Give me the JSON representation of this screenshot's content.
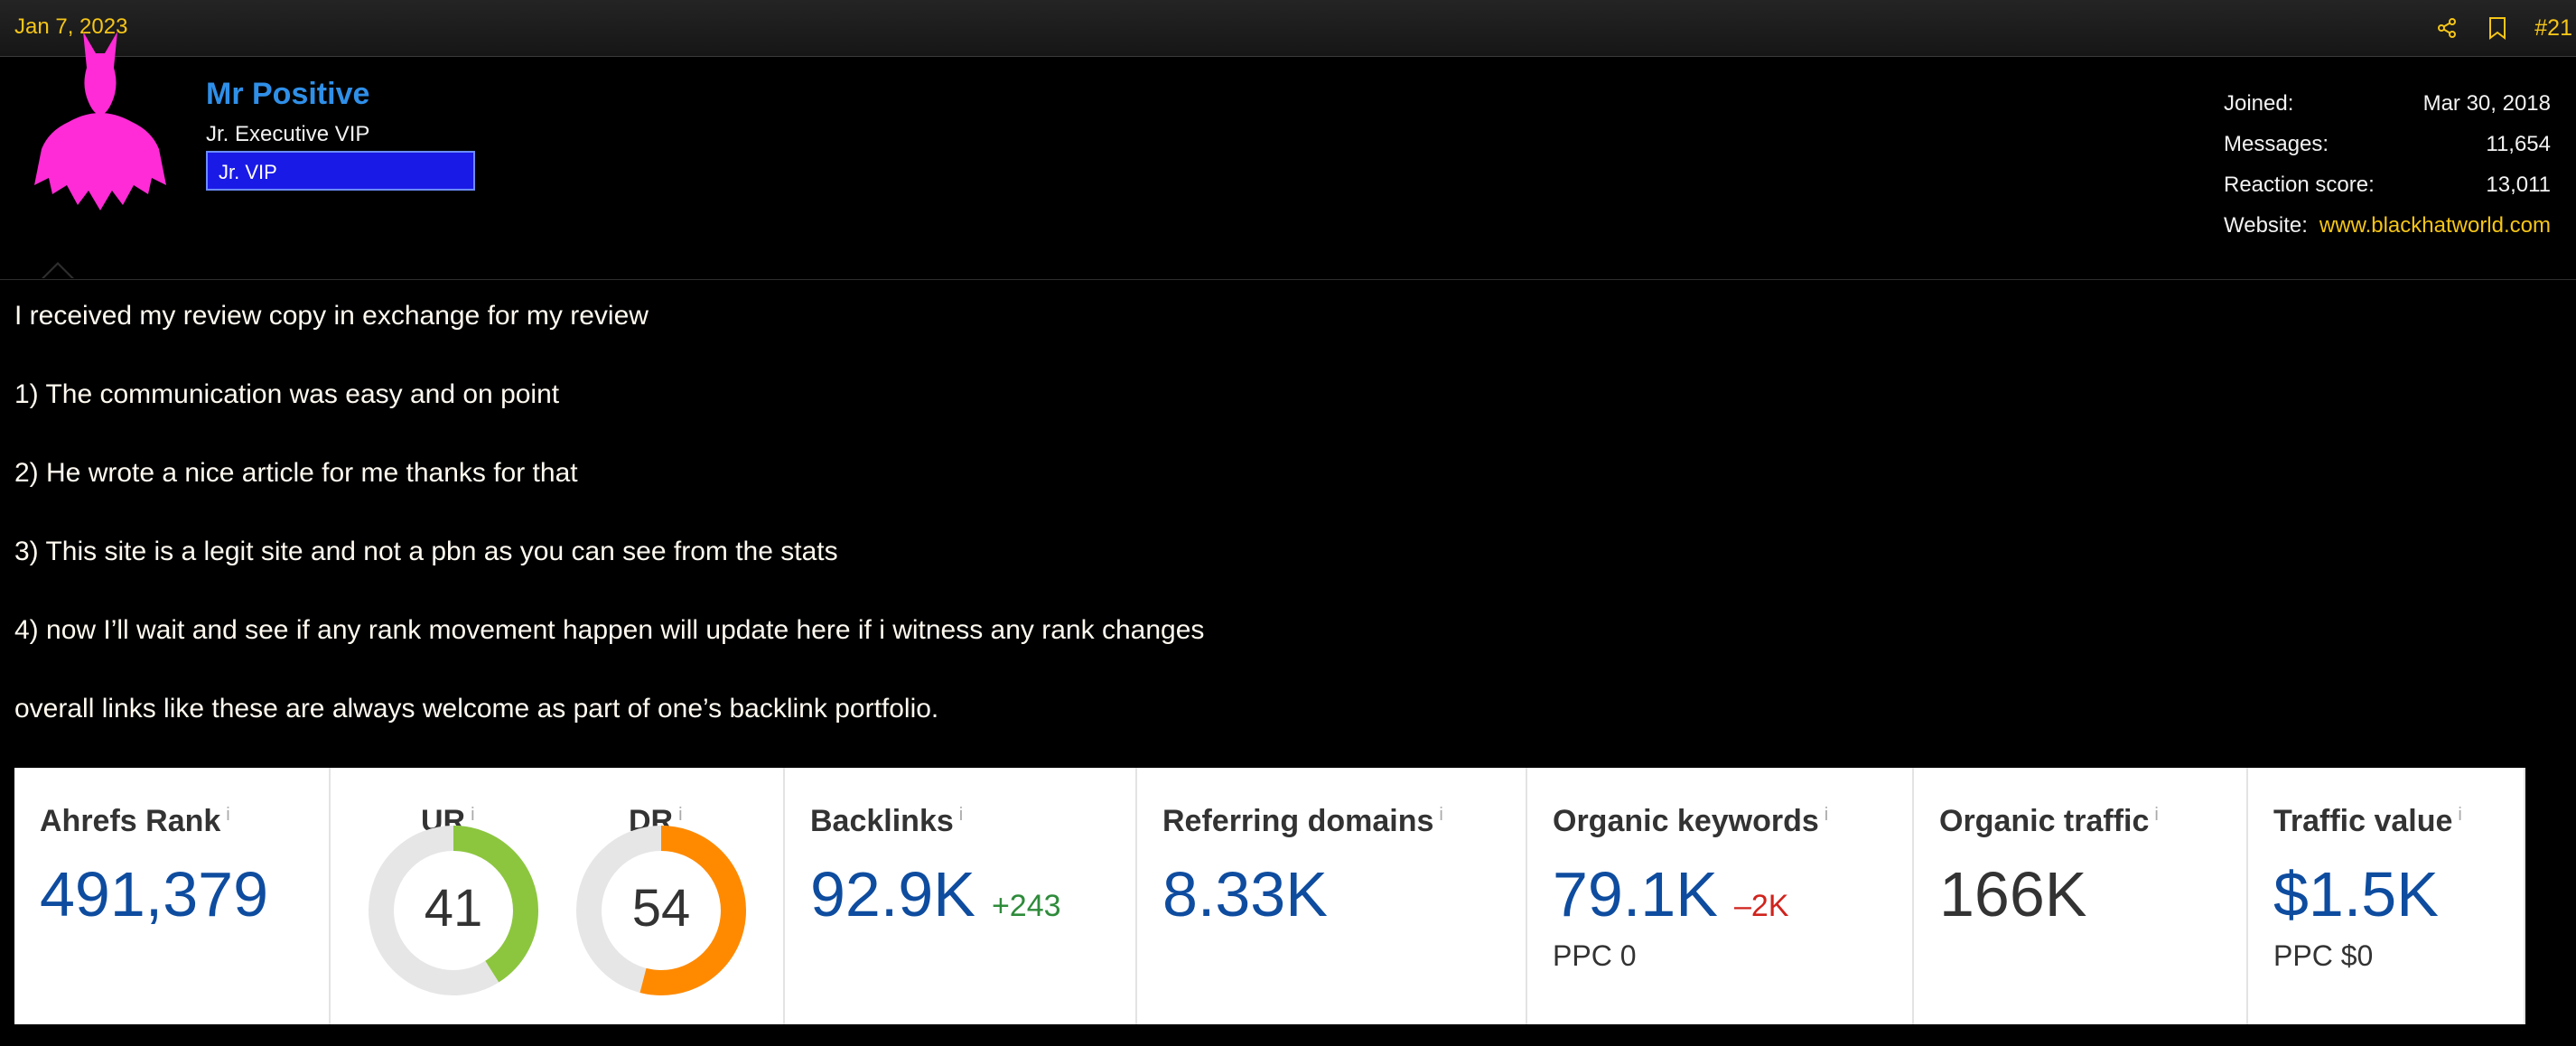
{
  "post": {
    "date": "Jan 7, 2023",
    "number": "#21"
  },
  "user": {
    "name": "Mr Positive",
    "title": "Jr. Executive VIP",
    "banner": "Jr. VIP",
    "avatar_icon": "batman-icon",
    "avatar_color": "#ff2bd6"
  },
  "stats": [
    {
      "label": "Joined:",
      "value": "Mar 30, 2018"
    },
    {
      "label": "Messages:",
      "value": "11,654"
    },
    {
      "label": "Reaction score:",
      "value": "13,011"
    },
    {
      "label": "Website:",
      "value": "www.blackhatworld.com"
    }
  ],
  "message": [
    "I received my review copy in exchange for my review",
    "1) The communication was easy and on point",
    "2) He wrote a nice article for me thanks for that",
    "3) This site is a legit site and not a pbn as you can see from the stats",
    "4) now I’ll wait and see if any rank movement happen will update here if i witness any rank changes",
    "overall links like these are always welcome as part of one’s backlink portfolio."
  ],
  "ahrefs": {
    "info_marker": "i",
    "rank": {
      "label": "Ahrefs Rank",
      "value": "491,379"
    },
    "ur": {
      "label": "UR",
      "value": "41",
      "fraction": 0.41,
      "color": "#8cc63f"
    },
    "dr": {
      "label": "DR",
      "value": "54",
      "fraction": 0.54,
      "color": "#ff8a00"
    },
    "backlinks": {
      "label": "Backlinks",
      "value": "92.9K",
      "delta": "+243"
    },
    "refdomains": {
      "label": "Referring domains",
      "value": "8.33K"
    },
    "keywords": {
      "label": "Organic keywords",
      "value": "79.1K",
      "delta": "–2K",
      "sub": "PPC 0"
    },
    "traffic": {
      "label": "Organic traffic",
      "value": "166K"
    },
    "value": {
      "label": "Traffic value",
      "value": "$1.5K",
      "sub": "PPC $0"
    }
  },
  "colors": {
    "accent_yellow": "#f5c518",
    "username_blue": "#2f8fe8",
    "banner_blue": "#1a1ae6",
    "metric_blue": "#0e4c9f"
  }
}
